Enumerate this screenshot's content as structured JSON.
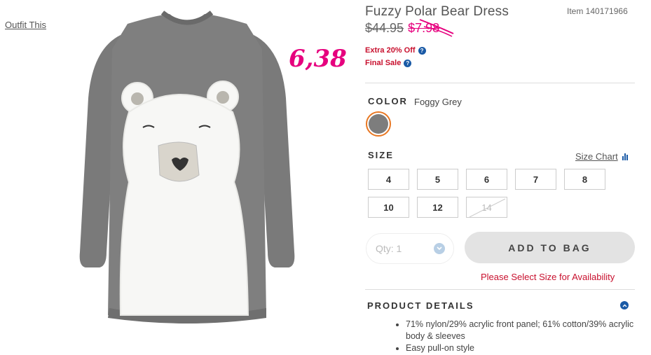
{
  "outfit_link": "Outfit This",
  "annotation": "6,38",
  "product": {
    "title": "Fuzzy Polar Bear Dress",
    "item_number": "Item 140171966",
    "original_price": "$44.95",
    "sale_price": "$7.98",
    "promos": [
      "Extra 20% Off",
      "Final Sale"
    ]
  },
  "color": {
    "heading": "COLOR",
    "selected_name": "Foggy Grey",
    "swatch_hex": "#7d7d7d"
  },
  "size": {
    "heading": "SIZE",
    "chart_link": "Size Chart",
    "options": [
      {
        "label": "4",
        "available": true
      },
      {
        "label": "5",
        "available": true
      },
      {
        "label": "6",
        "available": true
      },
      {
        "label": "7",
        "available": true
      },
      {
        "label": "8",
        "available": true
      },
      {
        "label": "10",
        "available": true
      },
      {
        "label": "12",
        "available": true
      },
      {
        "label": "14",
        "available": false
      }
    ]
  },
  "quantity": {
    "label": "Qty: 1"
  },
  "add_to_bag": "ADD TO BAG",
  "availability_message": "Please Select Size for Availability",
  "details": {
    "heading": "PRODUCT DETAILS",
    "items": [
      "71% nylon/29% acrylic front panel; 61% cotton/39% acrylic body & sleeves",
      "Easy pull-on style"
    ]
  },
  "colors": {
    "accent_pink": "#e6007e",
    "sale_red": "#c8102e",
    "info_blue": "#1a5aa6",
    "selected_ring": "#e87722"
  }
}
